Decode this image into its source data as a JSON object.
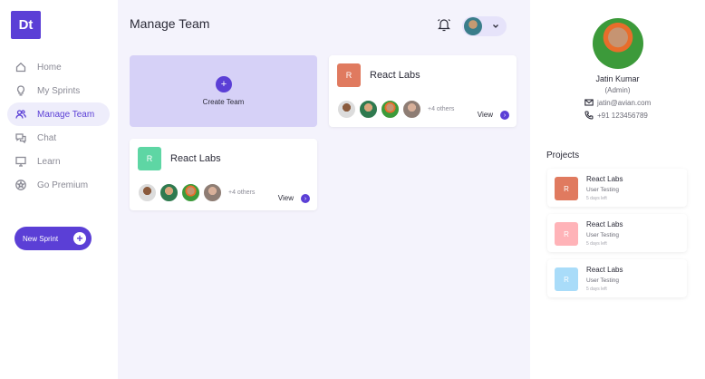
{
  "logo": "Dt",
  "sidebar": {
    "items": [
      {
        "label": "Home",
        "icon": "home-icon"
      },
      {
        "label": "My Sprints",
        "icon": "lightbulb-icon"
      },
      {
        "label": "Manage Team",
        "icon": "users-icon"
      },
      {
        "label": "Chat",
        "icon": "chat-icon"
      },
      {
        "label": "Learn",
        "icon": "monitor-icon"
      },
      {
        "label": "Go Premium",
        "icon": "star-icon"
      }
    ],
    "active_index": 2,
    "new_sprint_label": "New Sprint"
  },
  "main": {
    "title": "Manage Team",
    "create_team_label": "Create Team",
    "teams": [
      {
        "badge": "R",
        "name": "React Labs",
        "others": "+4 others",
        "view": "View",
        "badge_color": "#e07a5f"
      },
      {
        "badge": "R",
        "name": "React Labs",
        "others": "+4 others",
        "view": "View",
        "badge_color": "#5ed6a4"
      }
    ]
  },
  "profile": {
    "name": "Jatin Kumar",
    "role": "(Admin)",
    "email": "jatin@avian.com",
    "phone": "+91 123456789"
  },
  "projects": {
    "title": "Projects",
    "items": [
      {
        "badge": "R",
        "name": "React Labs",
        "subtitle": "User Testing",
        "time": "5 days left",
        "color": "#e07a5f"
      },
      {
        "badge": "R",
        "name": "React Labs",
        "subtitle": "User Testing",
        "time": "5 days left",
        "color": "#ffb3b8"
      },
      {
        "badge": "R",
        "name": "React Labs",
        "subtitle": "User Testing",
        "time": "5 days left",
        "color": "#a9dcf9"
      }
    ]
  },
  "colors": {
    "accent": "#5b3fd6",
    "create_card": "#d6d1f7",
    "main_bg": "#f4f3fc"
  }
}
